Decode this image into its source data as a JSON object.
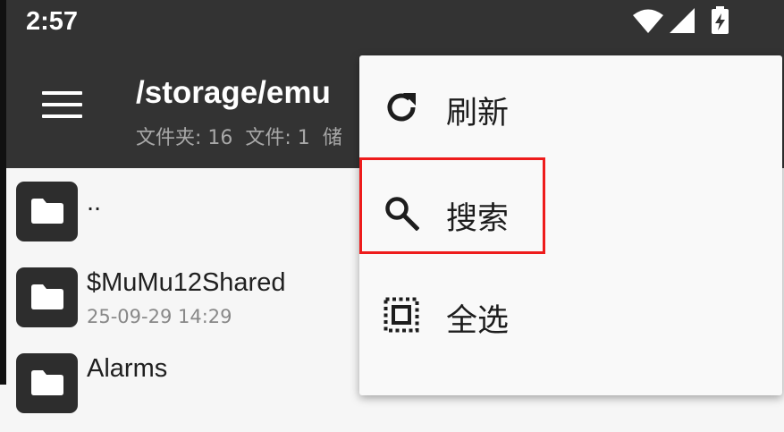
{
  "status_bar": {
    "time": "2:57",
    "icons": [
      "wifi-icon",
      "cell-signal-icon",
      "battery-charging-icon"
    ]
  },
  "app_bar": {
    "menu_icon": "hamburger-menu-icon",
    "path_title": "/storage/emu",
    "subtitle": {
      "folders": "文件夹: 16",
      "files": "文件: 1",
      "storage": "储"
    }
  },
  "files": [
    {
      "name": "..",
      "date": "",
      "icon": "folder-icon"
    },
    {
      "name": "$MuMu12Shared",
      "date": "25-09-29 14:29",
      "icon": "folder-icon"
    },
    {
      "name": "Alarms",
      "date": "",
      "icon": "folder-icon"
    }
  ],
  "overflow_menu": {
    "items": [
      {
        "label": "刷新",
        "icon": "refresh-icon"
      },
      {
        "label": "搜索",
        "icon": "search-icon"
      },
      {
        "label": "全选",
        "icon": "select-all-icon"
      }
    ]
  },
  "colors": {
    "app_bar": "#333333",
    "background": "#f6f6f6",
    "folder_tile": "#2d2d2d",
    "highlight": "#ee1c1c"
  }
}
